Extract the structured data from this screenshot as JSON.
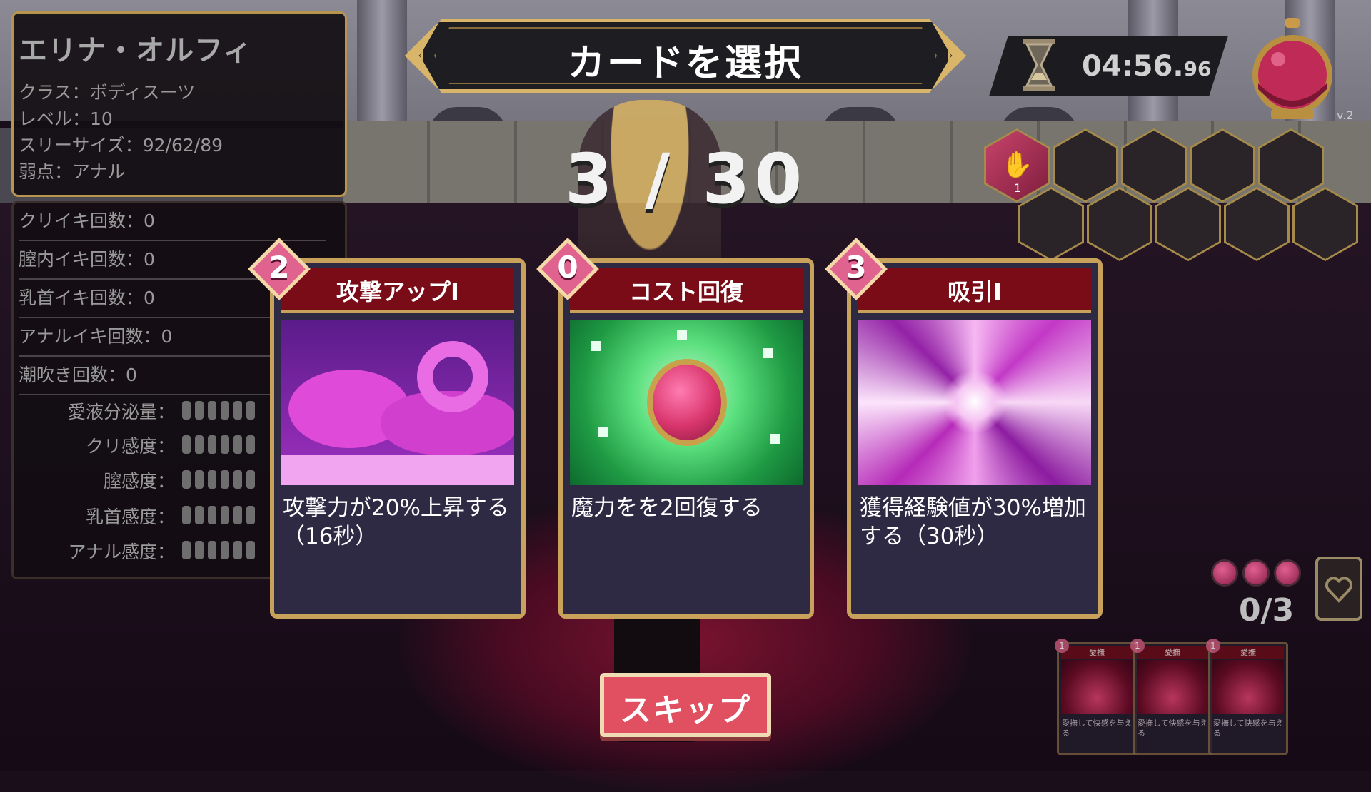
{
  "character": {
    "name": "エリナ・オルフィ",
    "class_line": "クラス：ボディスーツ",
    "level_line": "レベル：10",
    "sizes_line": "スリーサイズ：92/62/89",
    "weakness_line": "弱点：アナル"
  },
  "counts": [
    {
      "label": "クリイキ回数：0"
    },
    {
      "label": "膣内イキ回数：0"
    },
    {
      "label": "乳首イキ回数：0"
    },
    {
      "label": "アナルイキ回数：0"
    },
    {
      "label": "潮吹き回数：0"
    }
  ],
  "gauges": [
    {
      "label": "愛液分泌量："
    },
    {
      "label": "クリ感度："
    },
    {
      "label": "膣感度："
    },
    {
      "label": "乳首感度："
    },
    {
      "label": "アナル感度："
    }
  ],
  "banner": {
    "title": "カードを選択"
  },
  "timer": {
    "main": "04:56.",
    "ms": "96",
    "icon": "hourglass-icon"
  },
  "version": "v.2",
  "progress": {
    "text": "3 / 30",
    "current": 3,
    "total": 30
  },
  "buff_slot": {
    "count": "1",
    "icon": "hand-icon"
  },
  "cards": [
    {
      "cost": "2",
      "title": "攻撃アップI",
      "description": "攻撃力が20%上昇する（16秒）",
      "art": "tentacle-art"
    },
    {
      "cost": "0",
      "title": "コスト回復",
      "description": "魔力をを2回復する",
      "art": "heal-gem-art"
    },
    {
      "cost": "3",
      "title": "吸引I",
      "description": "獲得経験値が30%増加する（30秒）",
      "art": "vortex-art"
    }
  ],
  "deck": {
    "text": "0/3",
    "pips": 3
  },
  "mini_cards": [
    {
      "cost": "1",
      "title": "愛撫",
      "description": "愛撫して快感を与える"
    },
    {
      "cost": "1",
      "title": "愛撫",
      "description": "愛撫して快感を与える"
    },
    {
      "cost": "1",
      "title": "愛撫",
      "description": "愛撫して快感を与える"
    }
  ],
  "skip": {
    "label": "スキップ"
  },
  "colors": {
    "gold": "#c8a25a",
    "card_header": "#7a0c17",
    "skip": "#e05060",
    "cost_badge": "#e0628f"
  }
}
